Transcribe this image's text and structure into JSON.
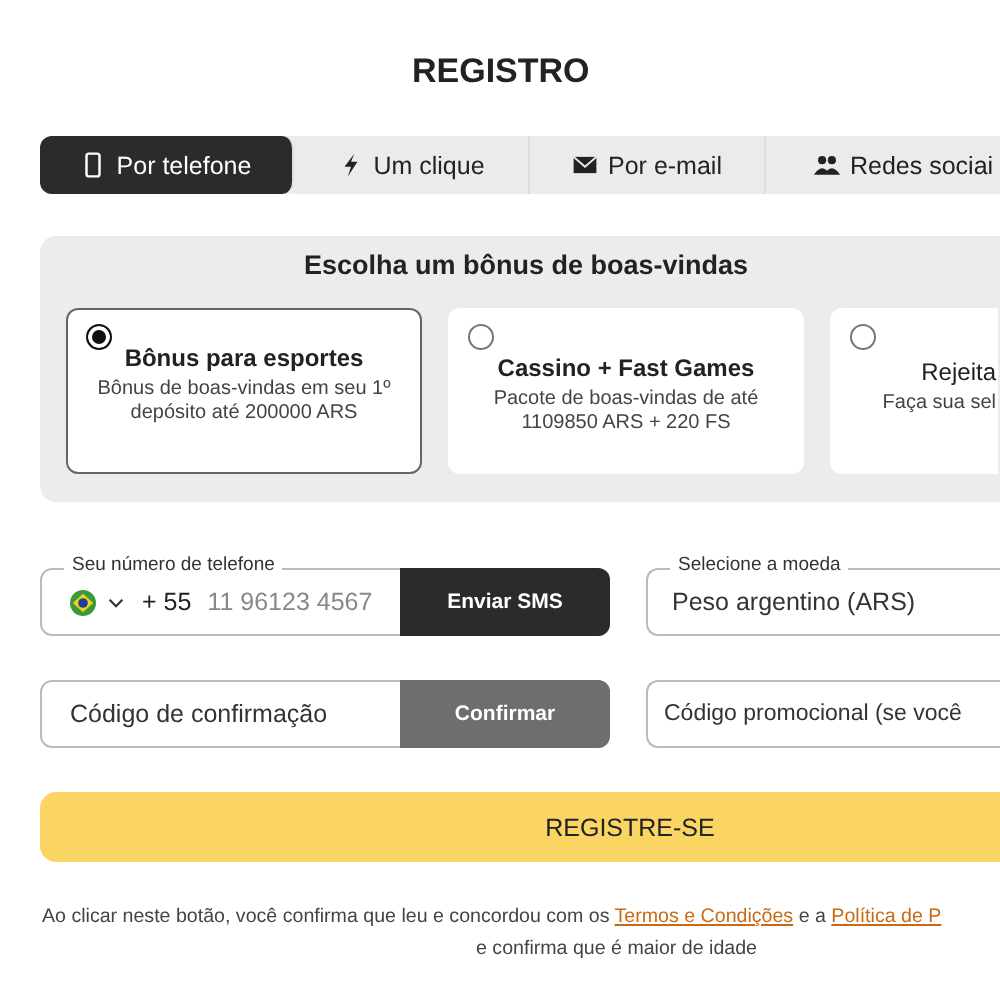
{
  "title": "REGISTRO",
  "tabs": [
    {
      "label": "Por telefone",
      "kind": "phone",
      "selected": true
    },
    {
      "label": "Um clique",
      "kind": "bolt",
      "selected": false
    },
    {
      "label": "Por e-mail",
      "kind": "mail",
      "selected": false
    },
    {
      "label": "Redes sociai",
      "kind": "users",
      "selected": false
    }
  ],
  "bonus": {
    "heading": "Escolha um bônus de boas-vindas",
    "options": [
      {
        "title": "Bônus para esportes",
        "description": "Bônus de boas-vindas em seu 1º depósito até 200000 ARS",
        "selected": true
      },
      {
        "title": "Cassino + Fast Games",
        "description": "Pacote de boas-vindas de até 1109850 ARS + 220 FS",
        "selected": false
      },
      {
        "title": "Rejeita",
        "description": "Faça sua sel",
        "selected": false
      }
    ]
  },
  "phone": {
    "label": "Seu número de telefone",
    "code": "+ 55",
    "placeholder": "11 96123 4567",
    "button": "Enviar SMS"
  },
  "currency": {
    "label": "Selecione a moeda",
    "value": "Peso argentino (ARS)"
  },
  "confirmation": {
    "placeholder": "Código de confirmação",
    "button": "Confirmar"
  },
  "promo": {
    "placeholder": "Código promocional (se você"
  },
  "submit": "REGISTRE-SE",
  "legal": {
    "line_1": "Ao clicar neste botão, você confirma que leu e concordou com os",
    "link_1": "Termos e Condições",
    "joiner": "e a",
    "link_2": "Política de P",
    "line_2": "e confirma que é maior de idade"
  }
}
